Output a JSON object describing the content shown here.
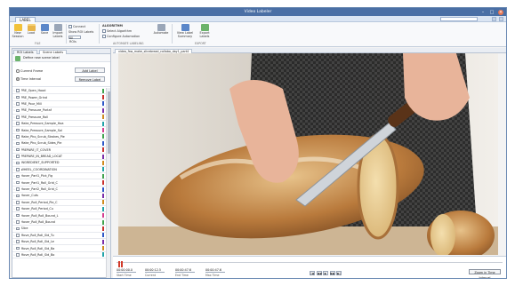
{
  "window": {
    "title": "Video Labeler"
  },
  "ribbon": {
    "tab_label": "LABEL",
    "buttons": [
      {
        "label": "New Session",
        "icon": "new-session-icon"
      },
      {
        "label": "Load",
        "icon": "folder-icon"
      },
      {
        "label": "Save",
        "icon": "save-icon"
      },
      {
        "label": "Import Labels",
        "icon": "import-icon"
      }
    ],
    "options": [
      {
        "label": "Connect",
        "kind": "checkbox"
      },
      {
        "label": "Show ROI Labels",
        "kind": "label"
      },
      {
        "label": "All ROIs",
        "kind": "dropdown"
      }
    ],
    "algorithm": {
      "title": "ALGORITHM",
      "items": [
        "Select Algorithm",
        "Configure Automation"
      ]
    },
    "buttons_right": [
      {
        "label": "Automate",
        "icon": "automate-icon"
      },
      {
        "label": "View Label Summary",
        "icon": "summary-icon"
      },
      {
        "label": "Export Labels",
        "icon": "export-icon"
      }
    ],
    "group_labels": [
      "FILE",
      "AUTOMATE LABELING",
      "EXPORT"
    ]
  },
  "left_panel": {
    "tabs": [
      "ROI Labels",
      "Scene Labels"
    ],
    "define_label": "Define new scene label",
    "radios": [
      {
        "label": "Current Frame",
        "selected": false
      },
      {
        "label": "Time Interval",
        "selected": true
      }
    ],
    "buttons": [
      "Add Label",
      "Remove Label"
    ],
    "labels": [
      {
        "name": "PRE_Open_Hood",
        "color": "#3fa34d"
      },
      {
        "name": "PRE_Power_Grind",
        "color": "#c9302c"
      },
      {
        "name": "PRE_Pour_Mill",
        "color": "#2b56c7"
      },
      {
        "name": "PRE_Pressure_Portaf",
        "color": "#7a2da8"
      },
      {
        "name": "PRE_Pressure_Roll",
        "color": "#d08a1e"
      },
      {
        "name": "Make_Pressure_Sample_Hoa",
        "color": "#1fa3a8"
      },
      {
        "name": "Make_Pressure_Sample_Sol",
        "color": "#d43c8f"
      },
      {
        "name": "Make_Pho_Scrub_Strokes_Pie",
        "color": "#3fa34d"
      },
      {
        "name": "Make_Pho_Scrub_Sides_Pie",
        "color": "#2b56c7"
      },
      {
        "name": "PREPARE_IT_COVER",
        "color": "#c9302c"
      },
      {
        "name": "PREPARE_IN_BREAD_LOCAT",
        "color": "#7a2da8"
      },
      {
        "name": "INGREDIENT_SUPPORTED",
        "color": "#d08a1e"
      },
      {
        "name": "WHEEL_COORDINATION",
        "color": "#1fa3a8"
      },
      {
        "name": "Hover_Part1_Pick_Fig",
        "color": "#3fa34d"
      },
      {
        "name": "Hover_Part1_Roll_Grid_C",
        "color": "#c9302c"
      },
      {
        "name": "Hover_Part2_Roll_Grid_C",
        "color": "#2b56c7"
      },
      {
        "name": "Hover_Cuts",
        "color": "#7a2da8"
      },
      {
        "name": "Hover_Roll_Period_Pie_C",
        "color": "#d08a1e"
      },
      {
        "name": "Hover_Roll_Period_Cu",
        "color": "#1fa3a8"
      },
      {
        "name": "Hover_Roll_Roll_Bound_L",
        "color": "#d43c8f"
      },
      {
        "name": "Hover_Roll_Roll_Bound",
        "color": "#3fa34d"
      },
      {
        "name": "Slice",
        "color": "#c9302c"
      },
      {
        "name": "Move_Roll_Roll_Sid_Tu",
        "color": "#2b56c7"
      },
      {
        "name": "Move_Roll_Roll_Sid_Le",
        "color": "#7a2da8"
      },
      {
        "name": "Move_Roll_Roll_Sid_Ba",
        "color": "#d08a1e"
      },
      {
        "name": "Move_Roll_Roll_Sid_Bo",
        "color": "#1fa3a8"
      }
    ]
  },
  "video": {
    "tab_label": "video_fsw_make_slicebread_collabo_day1_part4",
    "description": "Hands slicing a crusty baguette with a kitchen knife on a wooden board."
  },
  "timeline": {
    "fields": [
      {
        "value": "00:00:00.0",
        "caption": "Start Time"
      },
      {
        "value": "00:00:12.5",
        "caption": "Current"
      },
      {
        "value": "00:00:47.6",
        "caption": "End Time"
      },
      {
        "value": "00:00:47.6",
        "caption": "Max Time"
      }
    ],
    "player": [
      "|◀",
      "◀◀",
      "▶",
      "▶▶",
      "▶|"
    ],
    "interval_button": "Zoom in Time Interval"
  }
}
